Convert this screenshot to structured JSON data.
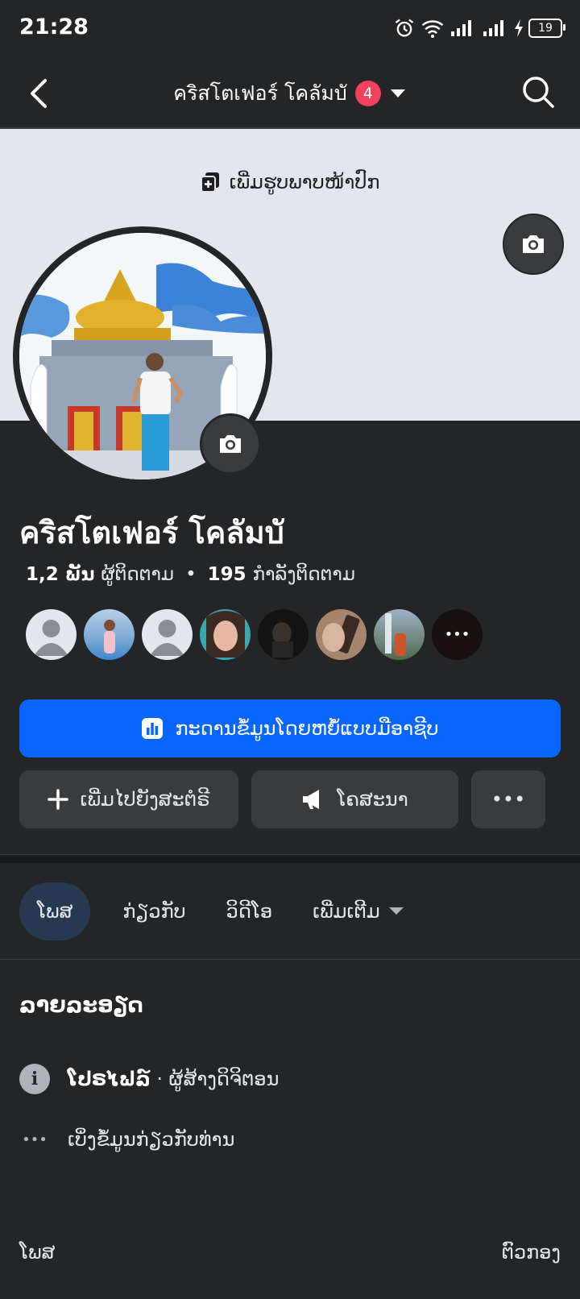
{
  "status_bar": {
    "time": "21:28",
    "battery": "19"
  },
  "header": {
    "title": "คริสโตเฟอร์ โคลัมบั",
    "badge": "4"
  },
  "cover": {
    "add_cover_label": "ເພີ່ມຮູບພາບໜ້າປົກ"
  },
  "profile": {
    "name": "คริสโตเฟอร์ โคลัมบั",
    "followers_count": "1,2 ພັນ",
    "followers_label": "ຜູ້ຕິດຕາມ",
    "separator": "•",
    "following_count": "195",
    "following_label": "ກໍາລັງຕິດຕາມ"
  },
  "friends": [
    {
      "type": "default-avatar"
    },
    {
      "type": "photo",
      "color": "#8fb3d9"
    },
    {
      "type": "default-avatar"
    },
    {
      "type": "photo",
      "color": "#c98f7a"
    },
    {
      "type": "photo",
      "color": "#1e1e1e"
    },
    {
      "type": "photo",
      "color": "#8b6a5a"
    },
    {
      "type": "photo",
      "color": "#6b7d8f"
    },
    {
      "type": "more",
      "label": "•••"
    }
  ],
  "buttons": {
    "dashboard": "ກະດານຂໍ້ມູນໂດຍຫຍໍ້ແບບມືອາຊີບ",
    "add_to_story": "ເພີ່ມໄປຍັງສະຕໍຣີ",
    "advertise": "ໂຄສະນາ",
    "more": "•••"
  },
  "tabs": [
    {
      "label": "ໂພສ",
      "active": true
    },
    {
      "label": "ກ່ຽວກັບ",
      "active": false
    },
    {
      "label": "ວິດີໂອ",
      "active": false
    },
    {
      "label": "ເພີ່ມເຕີມ",
      "active": false,
      "dropdown": true
    }
  ],
  "details": {
    "title": "ລາຍລະອຽດ",
    "profile_type_bold": "ໂປຣໄຟລ໌",
    "profile_type_rest": " · ຜູ້ສ້າງດິຈິຕອນ",
    "see_about": "ເບິ່ງຂໍ້ມູນກ່ຽວກັບທ່ານ"
  },
  "footer": {
    "left": "ໂພສ",
    "right": "ຕົວກອງ"
  },
  "colors": {
    "accent": "#0866ff",
    "badge": "#f3425f",
    "bg": "#242527"
  }
}
